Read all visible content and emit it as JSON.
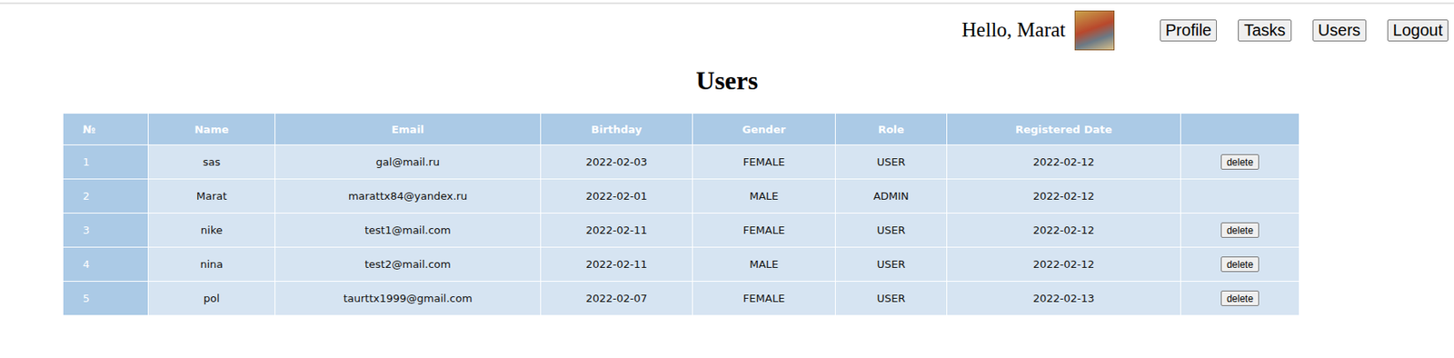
{
  "header": {
    "greeting": "Hello, Marat",
    "nav": [
      {
        "label": "Profile"
      },
      {
        "label": "Tasks"
      },
      {
        "label": "Users"
      },
      {
        "label": "Logout"
      }
    ]
  },
  "title": "Users",
  "table": {
    "columns": [
      "№",
      "Name",
      "Email",
      "Birthday",
      "Gender",
      "Role",
      "Registered Date",
      ""
    ],
    "delete_label": "delete",
    "rows": [
      {
        "cells": [
          "1",
          "sas",
          "gal@mail.ru",
          "2022-02-03",
          "FEMALE",
          "USER",
          "2022-02-12"
        ],
        "can_delete": true
      },
      {
        "cells": [
          "2",
          "Marat",
          "marattx84@yandex.ru",
          "2022-02-01",
          "MALE",
          "ADMIN",
          "2022-02-12"
        ],
        "can_delete": false
      },
      {
        "cells": [
          "3",
          "nike",
          "test1@mail.com",
          "2022-02-11",
          "FEMALE",
          "USER",
          "2022-02-12"
        ],
        "can_delete": true
      },
      {
        "cells": [
          "4",
          "nina",
          "test2@mail.com",
          "2022-02-11",
          "MALE",
          "USER",
          "2022-02-12"
        ],
        "can_delete": true
      },
      {
        "cells": [
          "5",
          "pol",
          "taurttx1999@gmail.com",
          "2022-02-07",
          "FEMALE",
          "USER",
          "2022-02-13"
        ],
        "can_delete": true
      }
    ]
  }
}
